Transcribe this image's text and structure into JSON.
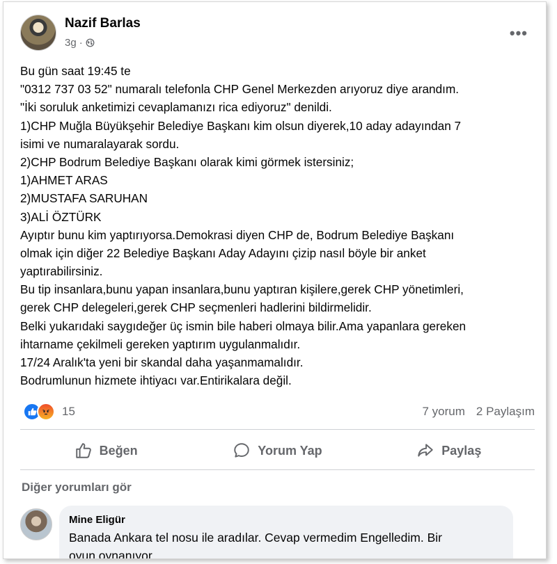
{
  "post": {
    "author": "Nazif Barlas",
    "time": "3g",
    "separator": "·",
    "privacy_icon": "globe-icon",
    "more_icon": "more-options-icon",
    "lines": [
      "Bu gün saat 19:45 te",
      "\"0312 737 03 52\" numaralı telefonla CHP Genel Merkezden arıyoruz diye arandım.",
      "\"İki soruluk anketimizi cevaplamanızı rica ediyoruz\" denildi.",
      "1)CHP Muğla Büyükşehir Belediye Başkanı kim olsun diyerek,10 aday adayından 7",
      "isimi ve numaralayarak sordu.",
      "2)CHP Bodrum Belediye Başkanı olarak kimi görmek istersiniz;",
      "1)AHMET ARAS",
      "2)MUSTAFA SARUHAN",
      "3)ALİ ÖZTÜRK",
      "Ayıptır bunu kim yaptırıyorsa.Demokrasi diyen CHP de, Bodrum Belediye Başkanı",
      "olmak için diğer 22 Belediye Başkanı Aday Adayını çizip nasıl böyle bir anket",
      "yaptırabilirsiniz.",
      "Bu tip insanlara,bunu yapan insanlara,bunu yaptıran kişilere,gerek CHP yönetimleri,",
      "gerek CHP delegeleri,gerek CHP seçmenleri hadlerini bildirmelidir.",
      "Belki yukarıdaki saygıdeğer üç ismin bile haberi olmaya bilir.Ama yapanlara gereken",
      "ihtarname çekilmeli gereken yaptırım uygulanmalıdır.",
      "17/24 Aralık'ta yeni bir skandal daha yaşanmamalıdır.",
      "Bodrumlunun hizmete ihtiyacı var.Entirikalara değil."
    ]
  },
  "reactions": {
    "icons": [
      "like-icon",
      "angry-icon"
    ],
    "count": "15",
    "comments": "7 yorum",
    "shares": "2 Paylaşım",
    "colors": {
      "like": "#1877f2",
      "angry": "#f7b125"
    }
  },
  "actions": {
    "like": "Beğen",
    "comment": "Yorum Yap",
    "share": "Paylaş"
  },
  "comments": {
    "see_more": "Diğer yorumları gör",
    "items": [
      {
        "author": "Mine Eligür",
        "lines": [
          "Banada Ankara tel nosu ile aradılar. Cevap vermedim Engelledim. Bir",
          "oyun oynanıyor."
        ]
      }
    ]
  }
}
